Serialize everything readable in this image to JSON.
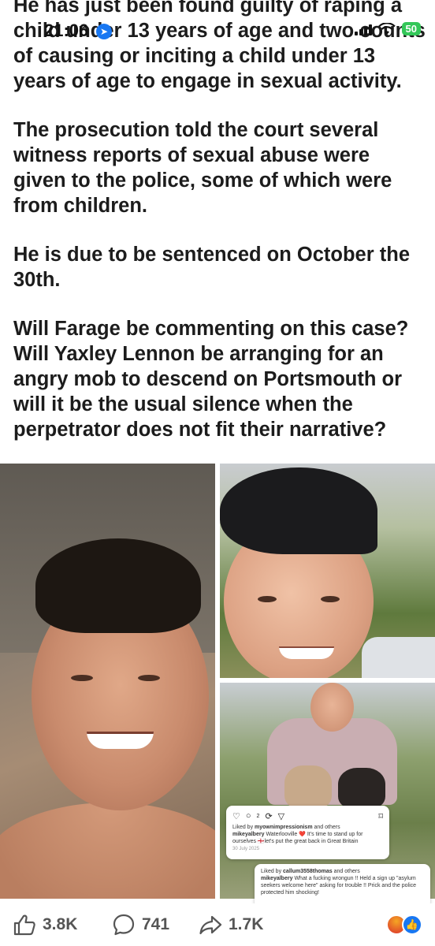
{
  "status": {
    "time": "21:06",
    "battery": "50"
  },
  "post": {
    "paragraphs": [
      "He has just been found guilty of raping a child under 13 years of age and two counts of causing or inciting a child under 13 years of age to engage in sexual activity.",
      "The prosecution told the court several witness reports of sexual abuse were given to the police, some of which were from children.",
      "He is due to be sentenced on October the 30th.",
      "Will Farage be commenting on this case? Will Yaxley Lennon be arranging for an angry mob to descend on Portsmouth or will it be the usual silence when the perpetrator does not fit their narrative?"
    ]
  },
  "photos": {
    "left": "selfie-photo",
    "top_right": "cap-selfie-photo",
    "bottom_right": "dogs-photo"
  },
  "instagram": {
    "card1": {
      "icon_count": "2",
      "liked_by_user": "myownimpressionism",
      "liked_suffix": "and others",
      "username": "mikeyalbery",
      "caption": "Waterlooville ❤️ It's time to stand up for ourselves 🏴󠁧󠁢󠁥󠁮󠁧󠁿let's put the great back in Great Britain",
      "date": "30 July 2025"
    },
    "card2": {
      "liked_by_user": "callum3558thomas",
      "liked_suffix": "and others",
      "username": "mikeyalbery",
      "caption": "What a fucking wrongun !! Held a sign up \"asylum seekers welcome here\" asking for trouble !! Prick and the police protected him shocking!"
    }
  },
  "actions": {
    "likes": "3.8K",
    "comments": "741",
    "shares": "1.7K"
  },
  "icons": {
    "like": "thumbs-up-icon",
    "comment": "comment-bubble-icon",
    "share": "share-arrow-icon",
    "reaction_angry": "angry-reaction-icon",
    "reaction_like": "like-reaction-icon"
  },
  "colors": {
    "facebook_blue": "#1877f2",
    "battery_green": "#34c759"
  }
}
